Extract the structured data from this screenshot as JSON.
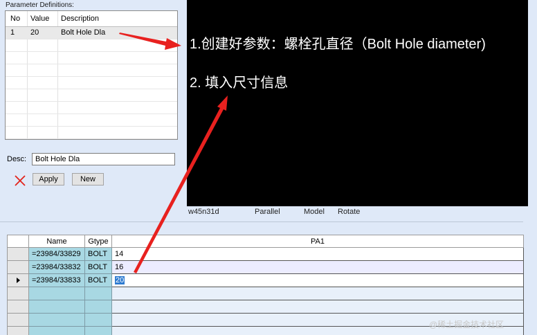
{
  "params": {
    "title": "Parameter Definitions:",
    "headers": {
      "no": "No",
      "value": "Value",
      "description": "Description"
    },
    "rows": [
      {
        "no": "1",
        "value": "20",
        "description": "Bolt Hole Dla"
      }
    ]
  },
  "desc": {
    "label": "Desc:",
    "value": "Bolt Hole Dla"
  },
  "buttons": {
    "apply": "Apply",
    "new": "New"
  },
  "annotations": {
    "step1": "1.创建好参数：螺栓孔直径（Bolt Hole diameter)",
    "step2": "2. 填入尺寸信息"
  },
  "status": {
    "model_name": "w45n31d",
    "projection": "Parallel",
    "mode": "Model",
    "action": "Rotate"
  },
  "grid": {
    "headers": {
      "name": "Name",
      "gtype": "Gtype",
      "pa1": "PA1"
    },
    "rows": [
      {
        "name": "=23984/33829",
        "gtype": "BOLT",
        "pa1": "14"
      },
      {
        "name": "=23984/33832",
        "gtype": "BOLT",
        "pa1": "16"
      },
      {
        "name": "=23984/33833",
        "gtype": "BOLT",
        "pa1": "20"
      }
    ]
  },
  "watermark": "@稀土掘金技术社区",
  "colors": {
    "arrow": "#e8211f",
    "preview_bg": "#000000",
    "grid_name_bg": "#a8d8e3",
    "selection": "#2f7bd0"
  }
}
